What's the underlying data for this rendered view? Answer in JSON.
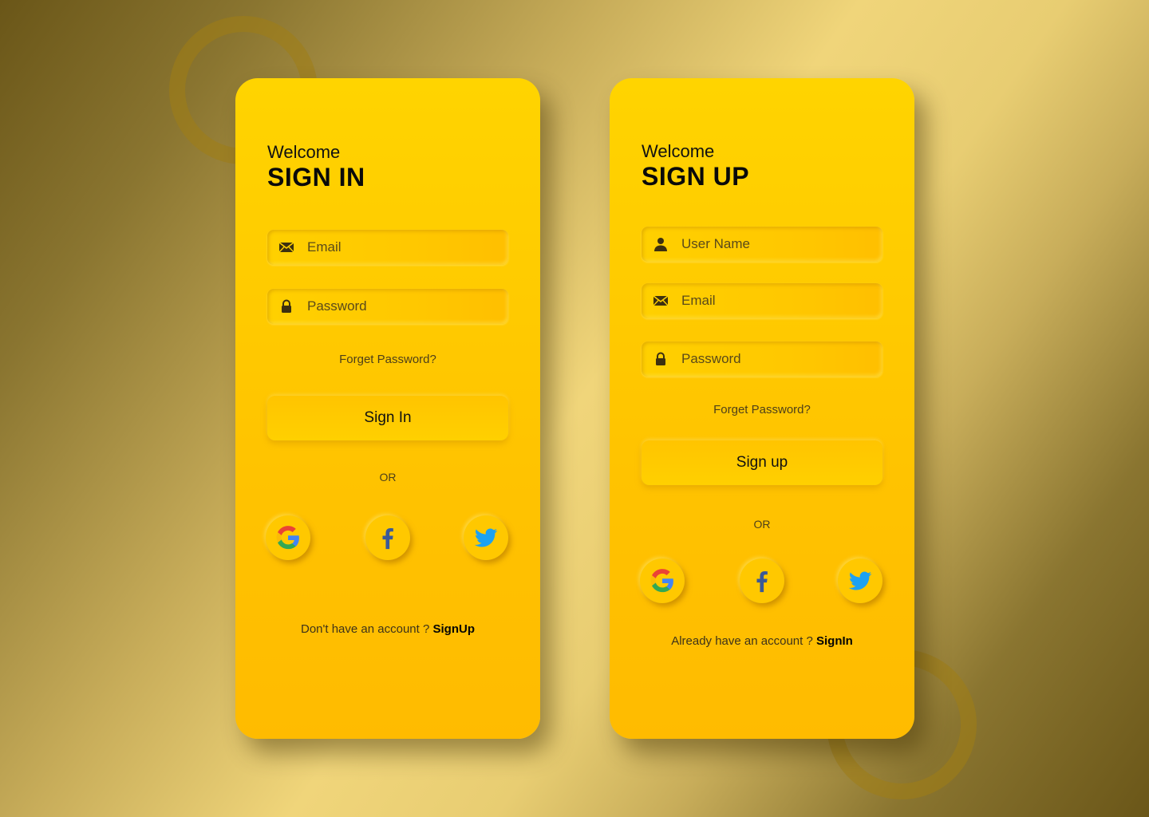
{
  "signin": {
    "welcome": "Welcome",
    "title": "SIGN IN",
    "fields": [
      {
        "label": "Email",
        "icon": "mail-icon"
      },
      {
        "label": "Password",
        "icon": "lock-icon"
      }
    ],
    "forgot": "Forget Password?",
    "button": "Sign In",
    "or": "OR",
    "footer_text": "Don't have an account ? ",
    "footer_link": "SignUp"
  },
  "signup": {
    "welcome": "Welcome",
    "title": "SIGN UP",
    "fields": [
      {
        "label": "User Name",
        "icon": "user-icon"
      },
      {
        "label": "Email",
        "icon": "mail-icon"
      },
      {
        "label": "Password",
        "icon": "lock-icon"
      }
    ],
    "forgot": "Forget Password?",
    "button": "Sign up",
    "or": "OR",
    "footer_text": "Already have an account ? ",
    "footer_link": "SignIn"
  },
  "social": [
    "google-icon",
    "facebook-icon",
    "twitter-icon"
  ],
  "colors": {
    "card": "#ffc800",
    "google_blue": "#4285F4",
    "google_red": "#EA4335",
    "google_yellow": "#FBBC05",
    "google_green": "#34A853",
    "facebook": "#3b5998",
    "twitter": "#1da1f2"
  }
}
